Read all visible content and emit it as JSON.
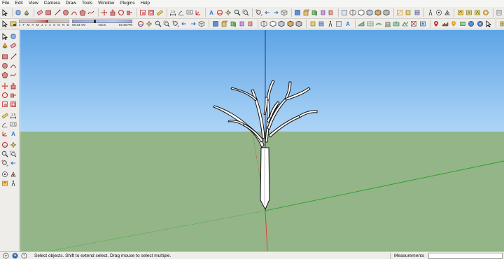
{
  "menu": [
    "File",
    "Edit",
    "View",
    "Camera",
    "Draw",
    "Tools",
    "Window",
    "Plugins",
    "Help"
  ],
  "shadow": {
    "months": [
      "J",
      "F",
      "M",
      "A",
      "M",
      "J",
      "J",
      "A",
      "S",
      "O",
      "N",
      "D"
    ],
    "time_start": "06:43 AM",
    "time_mid": "Noon",
    "time_end": "04:46 PM"
  },
  "toolbar_icons": [
    "select-icon",
    "component-icon",
    "paint-bucket-icon",
    "eraser-icon",
    "rectangle-icon",
    "line-icon",
    "circle-icon",
    "arc-icon",
    "polygon-icon",
    "freehand-icon",
    "move-icon",
    "push-pull-icon",
    "rotate-icon",
    "follow-me-icon",
    "scale-icon",
    "offset-icon",
    "tape-measure-icon",
    "dimension-icon",
    "protractor-icon",
    "text-icon",
    "axes-icon",
    "3d-text-icon",
    "orbit-icon",
    "pan-icon",
    "zoom-icon",
    "zoom-window-icon",
    "zoom-extents-icon",
    "previous-view-icon",
    "next-view-icon",
    "iso-view-icon",
    "top-view-icon",
    "front-view-icon",
    "right-view-icon",
    "back-view-icon",
    "left-view-icon",
    "xray-icon",
    "wireframe-icon",
    "hidden-line-icon",
    "shaded-icon",
    "textured-icon",
    "monochrome-icon",
    "section-plane-icon",
    "display-section-icon",
    "section-cut-icon",
    "walk-icon",
    "look-around-icon",
    "position-camera-icon",
    "warehouse-get-models-icon",
    "warehouse-share-model-icon",
    "warehouse-share-component-icon",
    "extension-icon",
    "layer-icon",
    "soften-icon",
    "sandbox-from-contours-icon",
    "sandbox-from-scratch-icon",
    "smoove-icon",
    "stamp-icon",
    "drape-icon",
    "add-detail-icon",
    "flip-edge-icon",
    "photo-match-icon",
    "geo-location-icon",
    "terrain-icon",
    "add-location-icon",
    "toggle-terrain-icon",
    "google-earth-icon",
    "preview-earth-icon"
  ],
  "status": {
    "message": "Select objects. Shift to extend select. Drag mouse to select multiple.",
    "measurements_label": "Measurements",
    "measurements_value": ""
  },
  "colors": {
    "sky_top": "#5da4e6",
    "sky_bottom": "#a9d2f5",
    "ground": "#93b588",
    "red_axis": "#e03a3a",
    "green_axis": "#2aa12a",
    "blue_axis": "#1c1c9c"
  }
}
